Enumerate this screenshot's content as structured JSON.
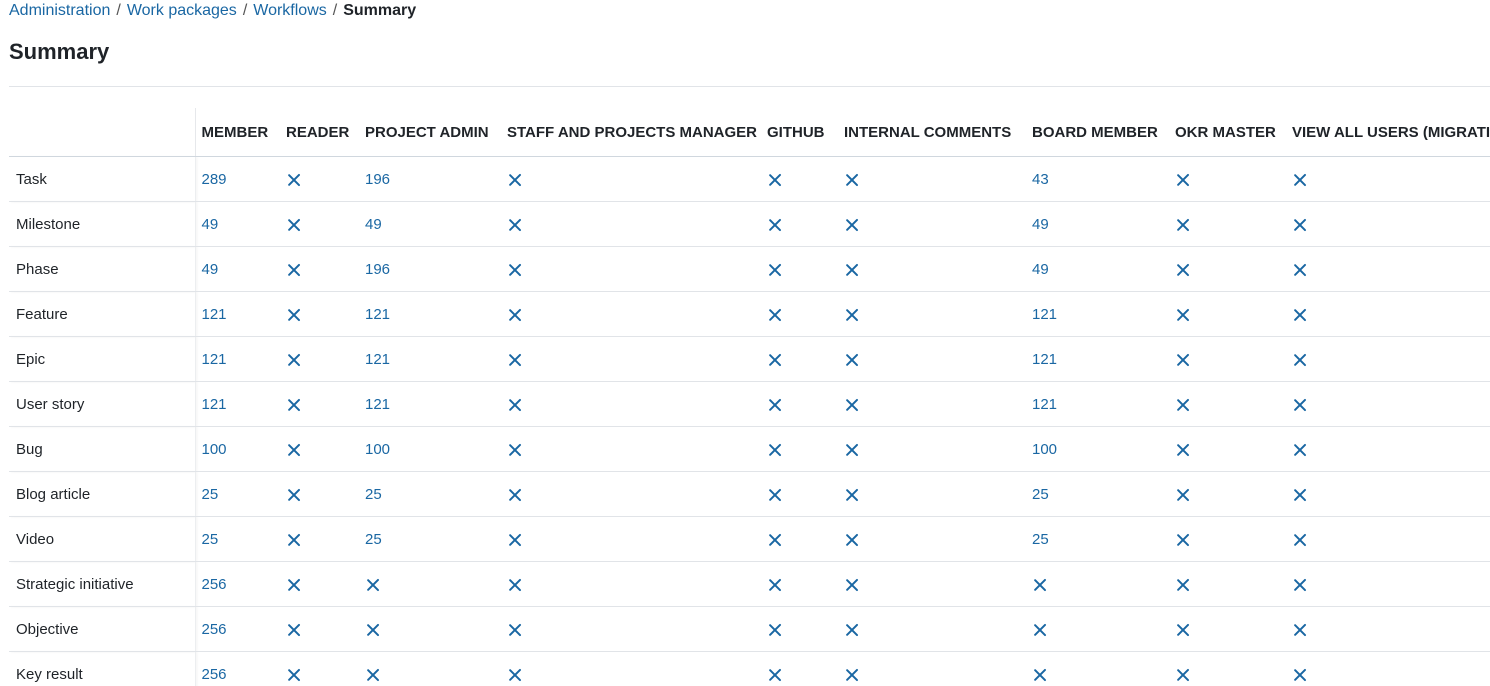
{
  "breadcrumb": {
    "items": [
      "Administration",
      "Work packages",
      "Workflows"
    ],
    "separator": "/",
    "current": "Summary"
  },
  "page_title": "Summary",
  "colors": {
    "link": "#1a67a3",
    "text": "#1f2328",
    "rule": "#e1e4e8"
  },
  "table": {
    "columns": [
      "MEMBER",
      "READER",
      "PROJECT ADMIN",
      "STAFF AND PROJECTS MANAGER",
      "GITHUB",
      "INTERNAL COMMENTS",
      "BOARD MEMBER",
      "OKR MASTER",
      "VIEW ALL USERS (MIGRATIO"
    ],
    "cell_icon": "x-icon",
    "rows": [
      {
        "label": "Task",
        "cells": [
          "289",
          null,
          "196",
          null,
          null,
          null,
          "43",
          null,
          null
        ]
      },
      {
        "label": "Milestone",
        "cells": [
          "49",
          null,
          "49",
          null,
          null,
          null,
          "49",
          null,
          null
        ]
      },
      {
        "label": "Phase",
        "cells": [
          "49",
          null,
          "196",
          null,
          null,
          null,
          "49",
          null,
          null
        ]
      },
      {
        "label": "Feature",
        "cells": [
          "121",
          null,
          "121",
          null,
          null,
          null,
          "121",
          null,
          null
        ]
      },
      {
        "label": "Epic",
        "cells": [
          "121",
          null,
          "121",
          null,
          null,
          null,
          "121",
          null,
          null
        ]
      },
      {
        "label": "User story",
        "cells": [
          "121",
          null,
          "121",
          null,
          null,
          null,
          "121",
          null,
          null
        ]
      },
      {
        "label": "Bug",
        "cells": [
          "100",
          null,
          "100",
          null,
          null,
          null,
          "100",
          null,
          null
        ]
      },
      {
        "label": "Blog article",
        "cells": [
          "25",
          null,
          "25",
          null,
          null,
          null,
          "25",
          null,
          null
        ]
      },
      {
        "label": "Video",
        "cells": [
          "25",
          null,
          "25",
          null,
          null,
          null,
          "25",
          null,
          null
        ]
      },
      {
        "label": "Strategic initiative",
        "cells": [
          "256",
          null,
          null,
          null,
          null,
          null,
          null,
          null,
          null
        ]
      },
      {
        "label": "Objective",
        "cells": [
          "256",
          null,
          null,
          null,
          null,
          null,
          null,
          null,
          null
        ]
      },
      {
        "label": "Key result",
        "cells": [
          "256",
          null,
          null,
          null,
          null,
          null,
          null,
          null,
          null
        ]
      }
    ]
  }
}
